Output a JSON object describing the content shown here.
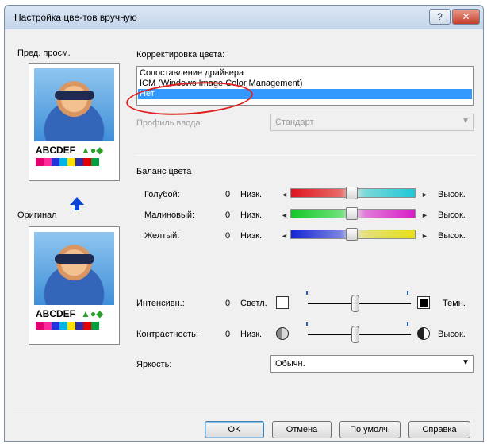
{
  "window": {
    "title": "Настройка цве-тов вручную",
    "help_glyph": "?",
    "close_glyph": "✕"
  },
  "preview": {
    "label": "Пред. просм.",
    "original_label": "Оригинал",
    "sample_text": "ABCDEF",
    "sample_shapes": "▲●◆",
    "swatch_colors": [
      "#e3006e",
      "#ff2a9a",
      "#2233dd",
      "#00b4e6",
      "#ffe100",
      "#2e2ea8",
      "#e40000",
      "#00a040"
    ]
  },
  "color_correction": {
    "label": "Корректировка цвета:",
    "options": [
      "Сопоставление драйвера",
      "ICM (Windows Image Color Management)",
      "Нет"
    ],
    "selected": "Нет",
    "input_profile_label": "Профиль ввода:",
    "input_profile_value": "Стандарт"
  },
  "color_balance": {
    "label": "Баланс цвета",
    "low_label": "Низк.",
    "high_label": "Высок.",
    "rows": [
      {
        "name": "Голубой:",
        "value": "0"
      },
      {
        "name": "Малиновый:",
        "value": "0"
      },
      {
        "name": "Желтый:",
        "value": "0"
      }
    ]
  },
  "intensity": {
    "label": "Интенсивн.:",
    "value": "0",
    "low_label": "Светл.",
    "high_label": "Темн.",
    "level": 0.5
  },
  "contrast": {
    "label": "Контрастность:",
    "value": "0",
    "low_label": "Низк.",
    "high_label": "Высок.",
    "level": 0.5
  },
  "brightness": {
    "label": "Яркость:",
    "value": "Обычн."
  },
  "buttons": {
    "ok": "OK",
    "cancel": "Отмена",
    "defaults": "По умолч.",
    "help": "Справка"
  }
}
